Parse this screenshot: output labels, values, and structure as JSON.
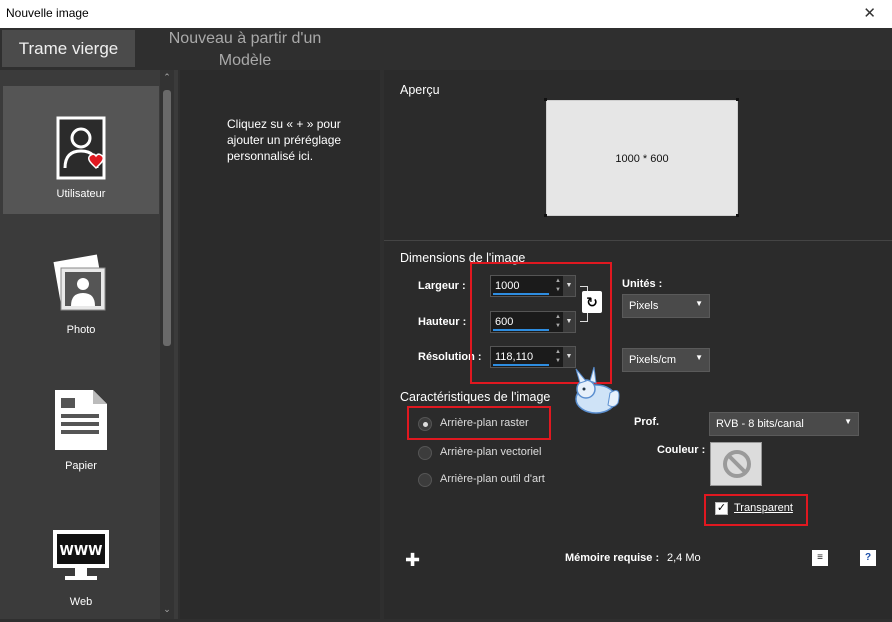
{
  "window": {
    "title": "Nouvelle image",
    "close_glyph": "✕"
  },
  "tabs": [
    {
      "label": "Trame vierge",
      "active": true
    },
    {
      "label": "Nouveau à partir d'un Modèle",
      "active": false
    }
  ],
  "sidebar": {
    "items": [
      {
        "label": "Utilisateur",
        "icon": "user-icon",
        "selected": true
      },
      {
        "label": "Photo",
        "icon": "photo-icon",
        "selected": false
      },
      {
        "label": "Papier",
        "icon": "paper-icon",
        "selected": false
      },
      {
        "label": "Web",
        "icon": "web-icon",
        "selected": false
      }
    ]
  },
  "presets": {
    "message": "Cliquez su « + » pour ajouter un préréglage personnalisé ici."
  },
  "preview": {
    "title": "Aperçu",
    "label": "1000 * 600"
  },
  "dimensions": {
    "title": "Dimensions de l'image",
    "width_label": "Largeur :",
    "width_value": "1000",
    "height_label": "Hauteur :",
    "height_value": "600",
    "resolution_label": "Résolution :",
    "resolution_value": "118,110",
    "units_label": "Unités :",
    "units_value": "Pixels",
    "resolution_units_value": "Pixels/cm"
  },
  "characteristics": {
    "title": "Caractéristiques de l'image",
    "options": [
      {
        "label": "Arrière-plan raster",
        "checked": true
      },
      {
        "label": "Arrière-plan vectoriel",
        "checked": false
      },
      {
        "label": "Arrière-plan outil d'art",
        "checked": false
      }
    ],
    "depth_label": "Prof.",
    "depth_value": "RVB - 8 bits/canal",
    "color_label": "Couleur :",
    "transparent_label": "Transparent",
    "transparent_checked": true
  },
  "footer": {
    "memory_label": "Mémoire requise :",
    "memory_value": "2,4 Mo",
    "help_glyph": "?"
  },
  "colors": {
    "highlight_red": "#e01820",
    "accent_blue": "#2e8de0",
    "panel": "#2b2b2b"
  }
}
